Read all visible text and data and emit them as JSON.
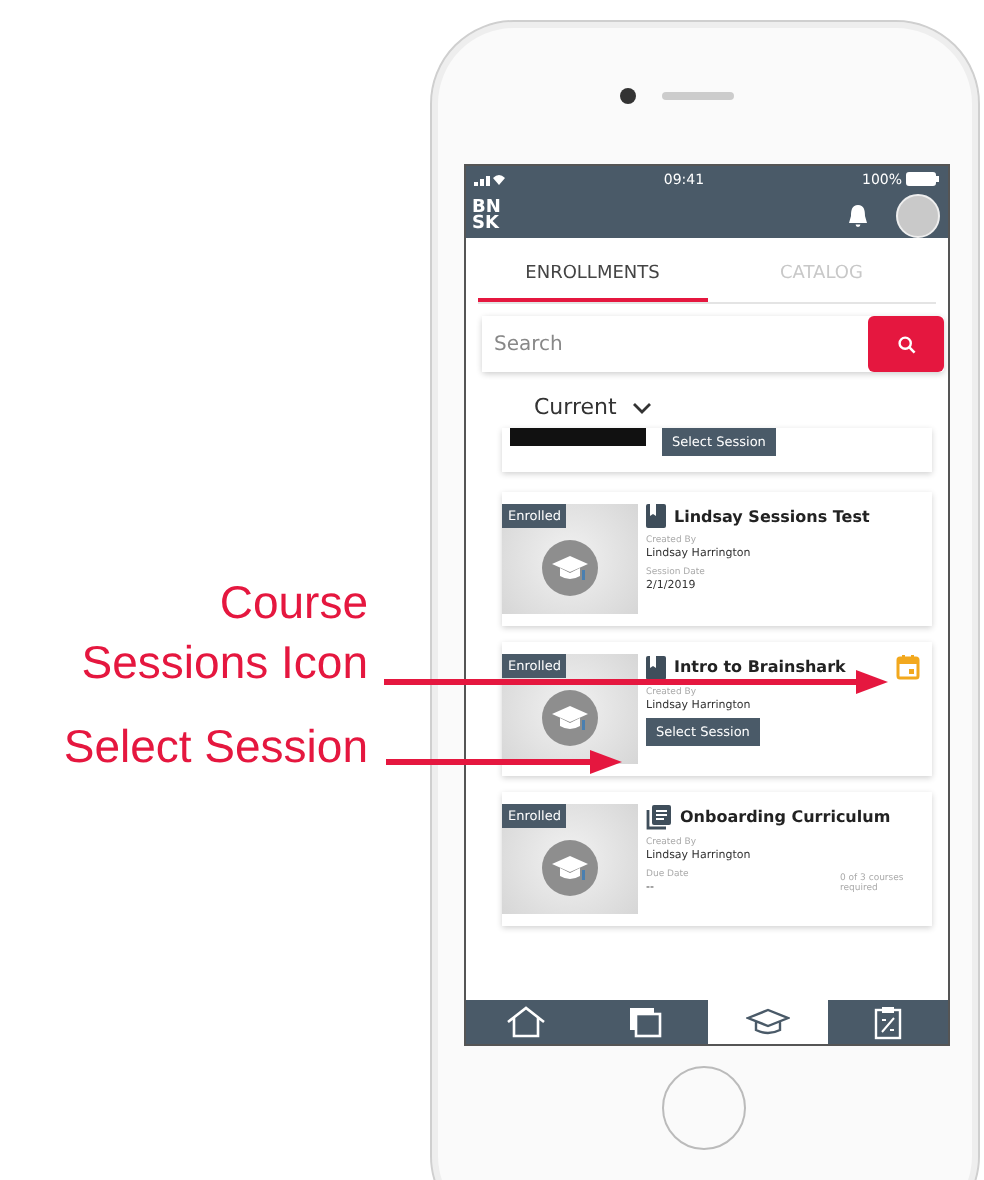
{
  "annotations": [
    {
      "text": "Course Sessions Icon"
    },
    {
      "text": "Select Session"
    }
  ],
  "status_bar": {
    "time": "09:41",
    "battery": "100%"
  },
  "header": {
    "logo_lines": [
      "BN",
      "SK"
    ]
  },
  "tabs": [
    {
      "label": "ENROLLMENTS",
      "selected": true
    },
    {
      "label": "CATALOG",
      "selected": false
    }
  ],
  "search": {
    "placeholder": "Search"
  },
  "filter": {
    "value": "Current"
  },
  "cards": [
    {
      "kind": "partial",
      "button": "Select Session"
    },
    {
      "kind": "course",
      "badge": "Enrolled",
      "title": "Lindsay Sessions Test",
      "created_by_label": "Created By",
      "author": "Lindsay Harrington",
      "date_label": "Session Date",
      "date": "2/1/2019"
    },
    {
      "kind": "course",
      "badge": "Enrolled",
      "title": "Intro to Brainshark",
      "created_by_label": "Created By",
      "author": "Lindsay Harrington",
      "button": "Select Session",
      "sessions_icon": true
    },
    {
      "kind": "curriculum",
      "badge": "Enrolled",
      "title": "Onboarding Curriculum",
      "created_by_label": "Created By",
      "author": "Lindsay Harrington",
      "date_label": "Due Date",
      "date": "--",
      "progress": "0 of 3 courses required"
    }
  ],
  "bottom_nav": [
    {
      "kind": "home",
      "selected": false
    },
    {
      "kind": "library",
      "selected": false
    },
    {
      "kind": "courses",
      "selected": true
    },
    {
      "kind": "tests",
      "selected": false
    }
  ]
}
